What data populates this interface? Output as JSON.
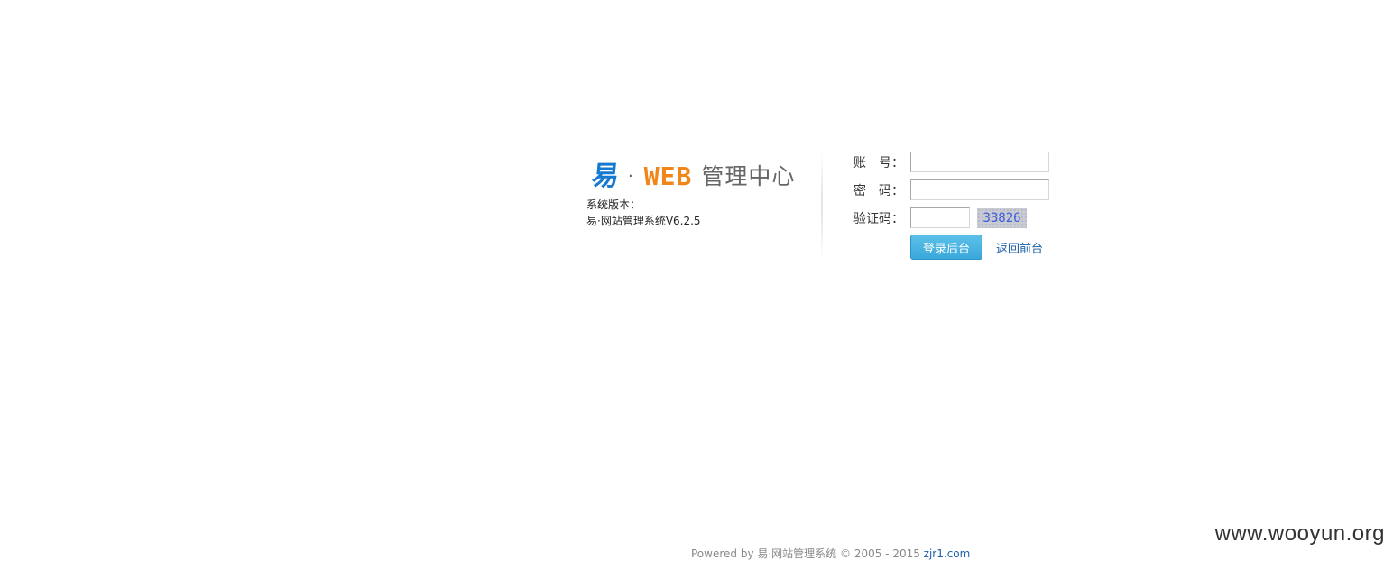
{
  "brand": {
    "logo_yi": "易",
    "logo_dot": "·",
    "logo_web": "WEB",
    "logo_center": "管理中心",
    "version_label": "系统版本：",
    "version_value": "易·网站管理系统V6.2.5"
  },
  "login": {
    "account_label_a": "账",
    "account_label_b": "号：",
    "account_value": "",
    "password_label_a": "密",
    "password_label_b": "码：",
    "password_value": "",
    "captcha_label": "验证码：",
    "captcha_value": "",
    "captcha_text": "33826",
    "submit_label": "登录后台",
    "back_link": "返回前台"
  },
  "footer": {
    "prefix": "Powered by 易·网站管理系统 © 2005 - 2015 ",
    "link": "zjr1.com"
  },
  "watermark": "www.wooyun.org",
  "colors": {
    "logo_blue": "#1479d0",
    "logo_orange": "#f08519",
    "button": "#3aa8dc",
    "link": "#1a5fa8"
  }
}
